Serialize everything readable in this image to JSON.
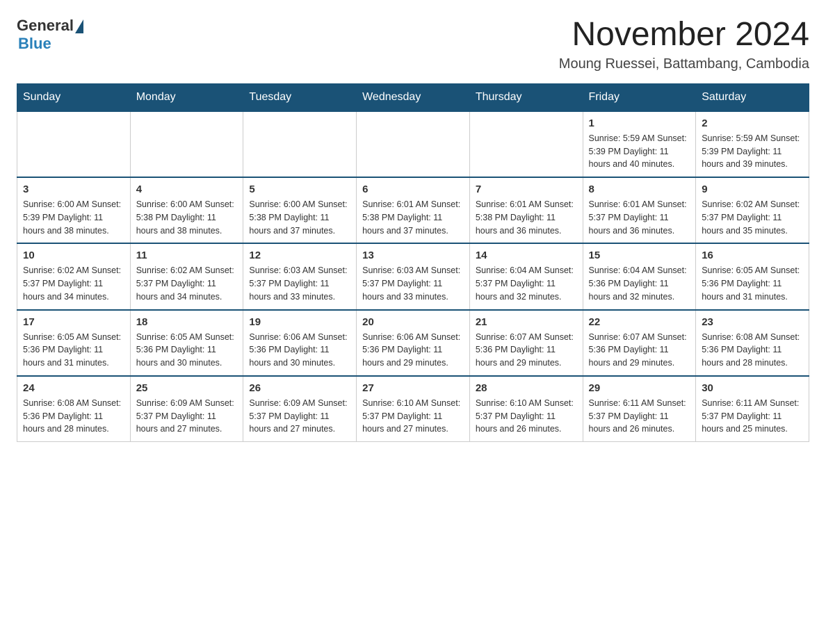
{
  "logo": {
    "general": "General",
    "blue": "Blue"
  },
  "title": "November 2024",
  "subtitle": "Moung Ruessei, Battambang, Cambodia",
  "days_of_week": [
    "Sunday",
    "Monday",
    "Tuesday",
    "Wednesday",
    "Thursday",
    "Friday",
    "Saturday"
  ],
  "weeks": [
    [
      {
        "day": "",
        "info": ""
      },
      {
        "day": "",
        "info": ""
      },
      {
        "day": "",
        "info": ""
      },
      {
        "day": "",
        "info": ""
      },
      {
        "day": "",
        "info": ""
      },
      {
        "day": "1",
        "info": "Sunrise: 5:59 AM\nSunset: 5:39 PM\nDaylight: 11 hours and 40 minutes."
      },
      {
        "day": "2",
        "info": "Sunrise: 5:59 AM\nSunset: 5:39 PM\nDaylight: 11 hours and 39 minutes."
      }
    ],
    [
      {
        "day": "3",
        "info": "Sunrise: 6:00 AM\nSunset: 5:39 PM\nDaylight: 11 hours and 38 minutes."
      },
      {
        "day": "4",
        "info": "Sunrise: 6:00 AM\nSunset: 5:38 PM\nDaylight: 11 hours and 38 minutes."
      },
      {
        "day": "5",
        "info": "Sunrise: 6:00 AM\nSunset: 5:38 PM\nDaylight: 11 hours and 37 minutes."
      },
      {
        "day": "6",
        "info": "Sunrise: 6:01 AM\nSunset: 5:38 PM\nDaylight: 11 hours and 37 minutes."
      },
      {
        "day": "7",
        "info": "Sunrise: 6:01 AM\nSunset: 5:38 PM\nDaylight: 11 hours and 36 minutes."
      },
      {
        "day": "8",
        "info": "Sunrise: 6:01 AM\nSunset: 5:37 PM\nDaylight: 11 hours and 36 minutes."
      },
      {
        "day": "9",
        "info": "Sunrise: 6:02 AM\nSunset: 5:37 PM\nDaylight: 11 hours and 35 minutes."
      }
    ],
    [
      {
        "day": "10",
        "info": "Sunrise: 6:02 AM\nSunset: 5:37 PM\nDaylight: 11 hours and 34 minutes."
      },
      {
        "day": "11",
        "info": "Sunrise: 6:02 AM\nSunset: 5:37 PM\nDaylight: 11 hours and 34 minutes."
      },
      {
        "day": "12",
        "info": "Sunrise: 6:03 AM\nSunset: 5:37 PM\nDaylight: 11 hours and 33 minutes."
      },
      {
        "day": "13",
        "info": "Sunrise: 6:03 AM\nSunset: 5:37 PM\nDaylight: 11 hours and 33 minutes."
      },
      {
        "day": "14",
        "info": "Sunrise: 6:04 AM\nSunset: 5:37 PM\nDaylight: 11 hours and 32 minutes."
      },
      {
        "day": "15",
        "info": "Sunrise: 6:04 AM\nSunset: 5:36 PM\nDaylight: 11 hours and 32 minutes."
      },
      {
        "day": "16",
        "info": "Sunrise: 6:05 AM\nSunset: 5:36 PM\nDaylight: 11 hours and 31 minutes."
      }
    ],
    [
      {
        "day": "17",
        "info": "Sunrise: 6:05 AM\nSunset: 5:36 PM\nDaylight: 11 hours and 31 minutes."
      },
      {
        "day": "18",
        "info": "Sunrise: 6:05 AM\nSunset: 5:36 PM\nDaylight: 11 hours and 30 minutes."
      },
      {
        "day": "19",
        "info": "Sunrise: 6:06 AM\nSunset: 5:36 PM\nDaylight: 11 hours and 30 minutes."
      },
      {
        "day": "20",
        "info": "Sunrise: 6:06 AM\nSunset: 5:36 PM\nDaylight: 11 hours and 29 minutes."
      },
      {
        "day": "21",
        "info": "Sunrise: 6:07 AM\nSunset: 5:36 PM\nDaylight: 11 hours and 29 minutes."
      },
      {
        "day": "22",
        "info": "Sunrise: 6:07 AM\nSunset: 5:36 PM\nDaylight: 11 hours and 29 minutes."
      },
      {
        "day": "23",
        "info": "Sunrise: 6:08 AM\nSunset: 5:36 PM\nDaylight: 11 hours and 28 minutes."
      }
    ],
    [
      {
        "day": "24",
        "info": "Sunrise: 6:08 AM\nSunset: 5:36 PM\nDaylight: 11 hours and 28 minutes."
      },
      {
        "day": "25",
        "info": "Sunrise: 6:09 AM\nSunset: 5:37 PM\nDaylight: 11 hours and 27 minutes."
      },
      {
        "day": "26",
        "info": "Sunrise: 6:09 AM\nSunset: 5:37 PM\nDaylight: 11 hours and 27 minutes."
      },
      {
        "day": "27",
        "info": "Sunrise: 6:10 AM\nSunset: 5:37 PM\nDaylight: 11 hours and 27 minutes."
      },
      {
        "day": "28",
        "info": "Sunrise: 6:10 AM\nSunset: 5:37 PM\nDaylight: 11 hours and 26 minutes."
      },
      {
        "day": "29",
        "info": "Sunrise: 6:11 AM\nSunset: 5:37 PM\nDaylight: 11 hours and 26 minutes."
      },
      {
        "day": "30",
        "info": "Sunrise: 6:11 AM\nSunset: 5:37 PM\nDaylight: 11 hours and 25 minutes."
      }
    ]
  ]
}
